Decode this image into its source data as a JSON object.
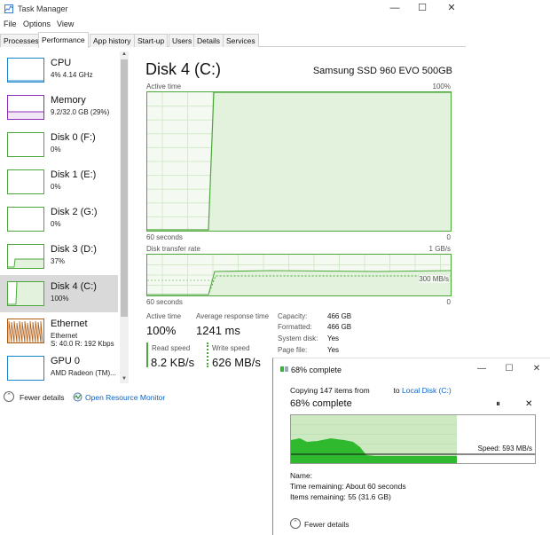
{
  "window": {
    "title": "Task Manager",
    "controls": [
      "—",
      "☐",
      "✕"
    ]
  },
  "menu": [
    "File",
    "Options",
    "View"
  ],
  "tabs": [
    {
      "label": "Processes"
    },
    {
      "label": "Performance"
    },
    {
      "label": "App history"
    },
    {
      "label": "Start-up"
    },
    {
      "label": "Users"
    },
    {
      "label": "Details"
    },
    {
      "label": "Services"
    }
  ],
  "active_tab": "Performance",
  "sidebar": {
    "items": [
      {
        "name": "CPU",
        "sub": "4% 4.14 GHz",
        "color": "#1a83c9",
        "selected": false
      },
      {
        "name": "Memory",
        "sub": "9.2/32.0 GB (29%)",
        "color": "#8c2eb5",
        "selected": false
      },
      {
        "name": "Disk 0 (F:)",
        "sub": "0%",
        "color": "#4da63a",
        "selected": false
      },
      {
        "name": "Disk 1 (E:)",
        "sub": "0%",
        "color": "#4da63a",
        "selected": false
      },
      {
        "name": "Disk 2 (G:)",
        "sub": "0%",
        "color": "#4da63a",
        "selected": false
      },
      {
        "name": "Disk 3 (D:)",
        "sub": "37%",
        "color": "#4da63a",
        "selected": false
      },
      {
        "name": "Disk 4 (C:)",
        "sub": "100%",
        "color": "#4da63a",
        "selected": true
      },
      {
        "name": "Ethernet",
        "sub": "Ethernet",
        "sub2": "S: 40.0 R: 192 Kbps",
        "color": "#b05a12",
        "selected": false
      },
      {
        "name": "GPU 0",
        "sub": "AMD Radeon (TM)...",
        "color": "#1a83c9",
        "selected": false
      }
    ]
  },
  "main": {
    "title": "Disk 4 (C:)",
    "model": "Samsung SSD 960 EVO 500GB",
    "active_time_chart": {
      "label": "Active time",
      "max_label": "100%",
      "left_label": "60 seconds",
      "right_label": "0"
    },
    "transfer_chart": {
      "label": "Disk transfer rate",
      "max_label": "1 GB/s",
      "mid_label": "300 MB/s",
      "left_label": "60 seconds",
      "right_label": "0"
    },
    "stats": {
      "active_time_label": "Active time",
      "active_time_value": "100%",
      "response_label": "Average response time",
      "response_value": "1241 ms",
      "read_label": "Read speed",
      "read_value": "8.2 KB/s",
      "write_label": "Write speed",
      "write_value": "626 MB/s"
    },
    "properties": [
      {
        "label": "Capacity:",
        "value": "466 GB"
      },
      {
        "label": "Formatted:",
        "value": "466 GB"
      },
      {
        "label": "System disk:",
        "value": "Yes"
      },
      {
        "label": "Page file:",
        "value": "Yes"
      }
    ]
  },
  "footer": {
    "fewer_details": "Fewer details",
    "resource_monitor": "Open Resource Monitor"
  },
  "copy_dialog": {
    "title": "68% complete",
    "copying_prefix": "Copying 147 items from",
    "copying_to": "to",
    "destination": "Local Disk (C:)",
    "percent_text": "68% complete",
    "progress": 0.68,
    "pause_glyph": "⏸",
    "cancel_glyph": "✕",
    "speed_label": "Speed: 593 MB/s",
    "name_label": "Name:",
    "time_remaining": "Time remaining:  About 60 seconds",
    "items_remaining": "Items remaining:  55 (31.6 GB)",
    "fewer_details": "Fewer details",
    "controls": [
      "—",
      "☐",
      "✕"
    ]
  },
  "colors": {
    "disk_green": "#4da63a",
    "cpu_blue": "#1a83c9",
    "memory_purple": "#8c2eb5",
    "ethernet_orange": "#b05a12",
    "copy_progress_green": "#2fb92f"
  }
}
